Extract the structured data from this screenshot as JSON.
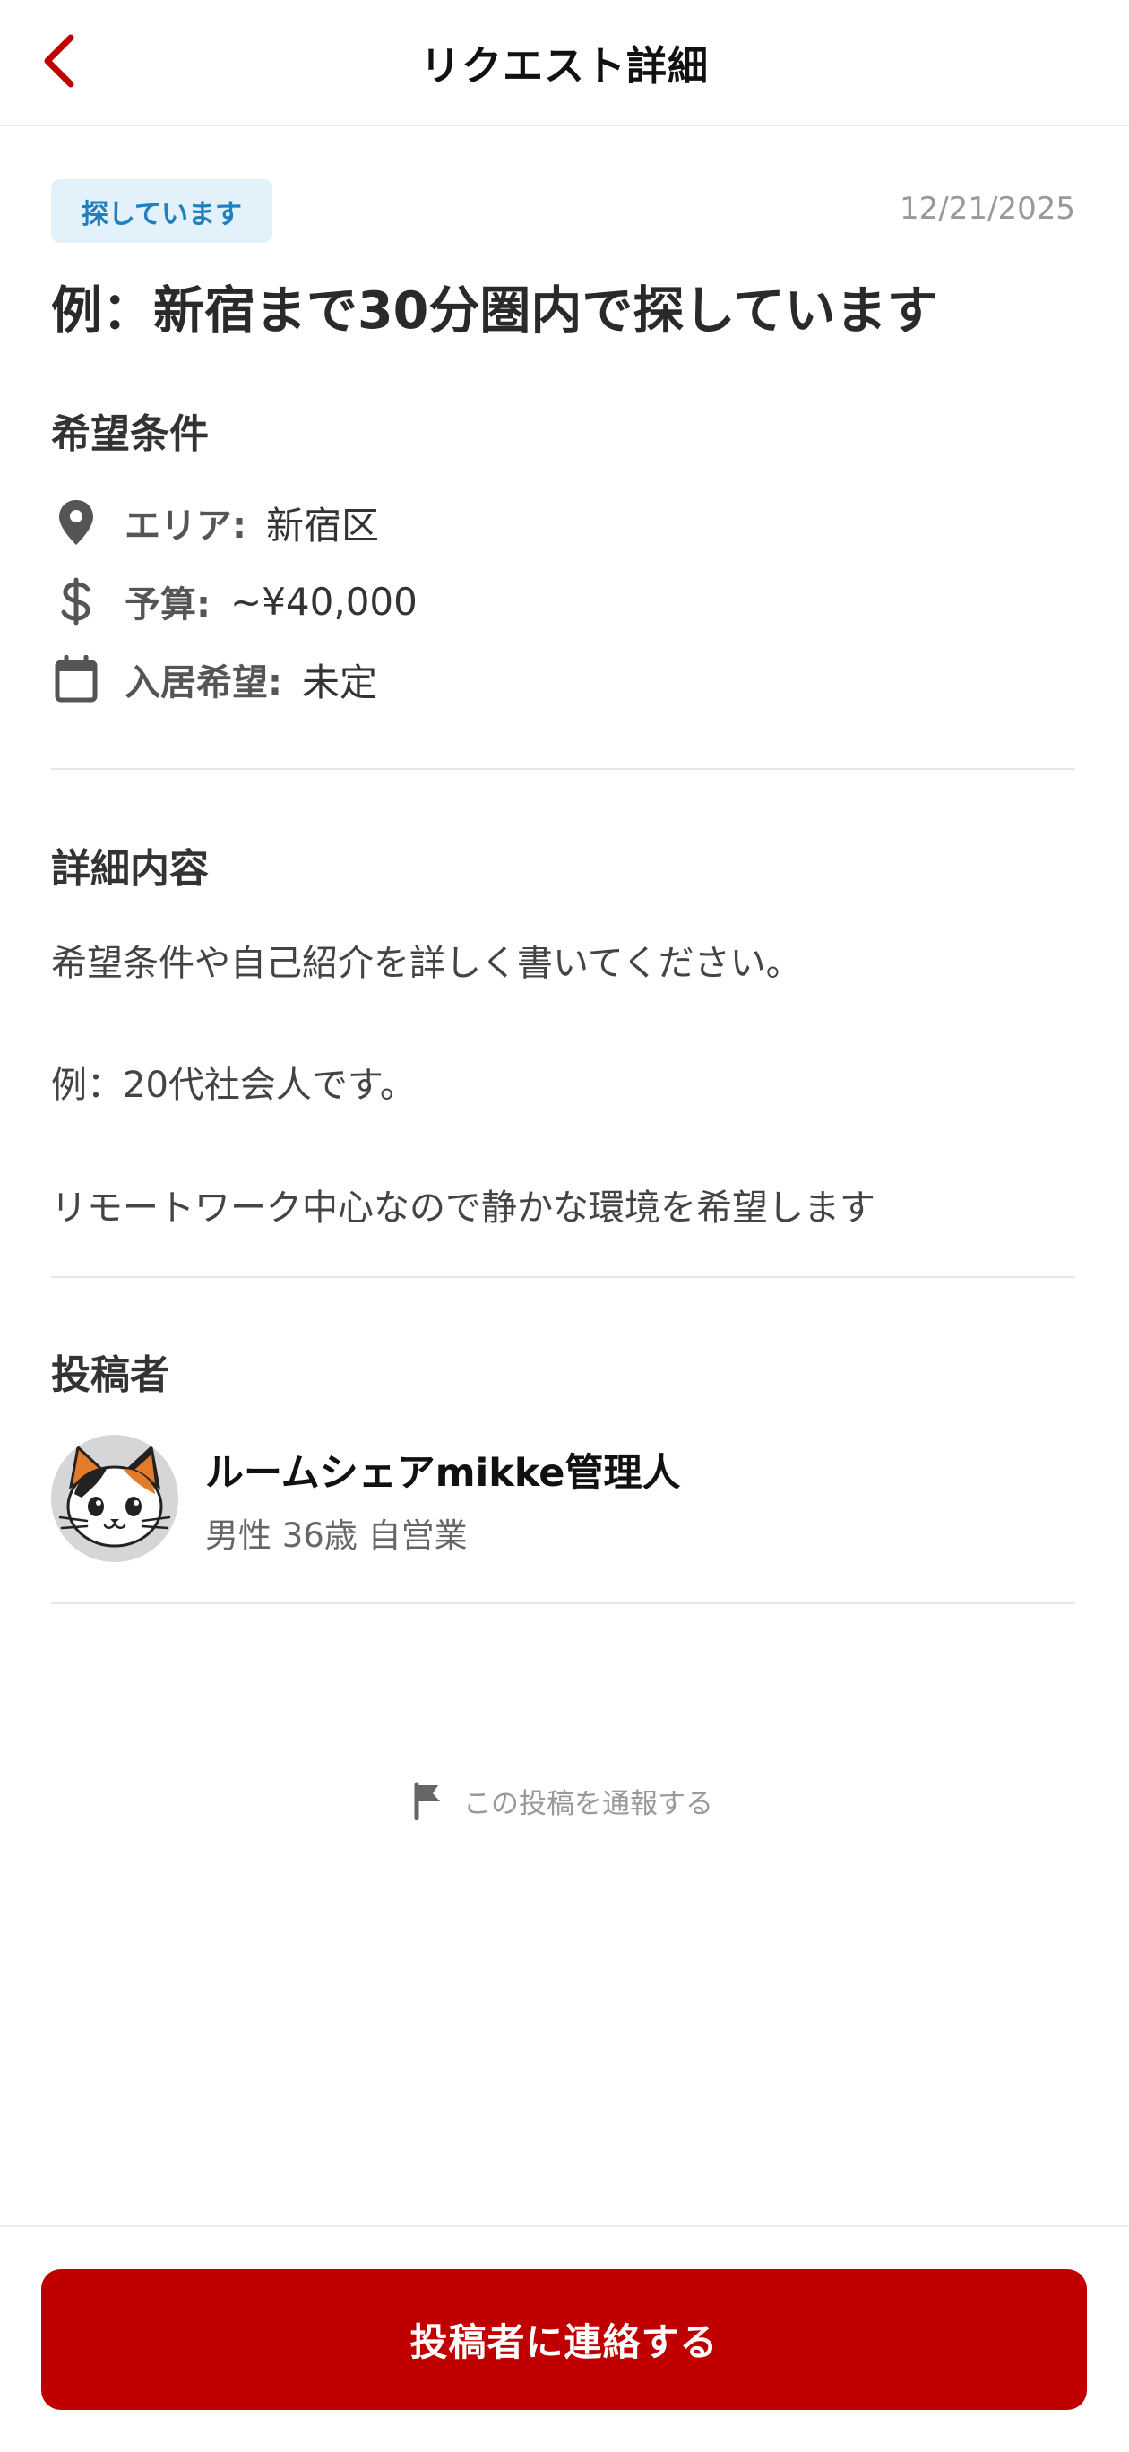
{
  "header": {
    "title": "リクエスト詳細",
    "back_icon": "chevron-left-icon",
    "accent_color": "#c00000"
  },
  "post": {
    "status_badge": "探しています",
    "date": "12/21/2025",
    "title": "例：新宿まで30分圏内で探しています"
  },
  "conditions": {
    "section_title": "希望条件",
    "items": [
      {
        "icon": "location-pin-icon",
        "label": "エリア:",
        "value": "新宿区"
      },
      {
        "icon": "dollar-icon",
        "label": "予算:",
        "value": "~¥40,000"
      },
      {
        "icon": "calendar-icon",
        "label": "入居希望:",
        "value": "未定"
      }
    ]
  },
  "details": {
    "section_title": "詳細内容",
    "lines": [
      "希望条件や自己紹介を詳しく書いてください。",
      "例：20代社会人です。",
      "リモートワーク中心なので静かな環境を希望します"
    ]
  },
  "poster": {
    "section_title": "投稿者",
    "avatar_icon": "cat-avatar-icon",
    "name": "ルームシェアmikke管理人",
    "meta": "男性 36歳 自営業"
  },
  "report": {
    "icon": "flag-icon",
    "label": "この投稿を通報する"
  },
  "footer": {
    "contact_button": "投稿者に連絡する",
    "button_color": "#c00000"
  }
}
